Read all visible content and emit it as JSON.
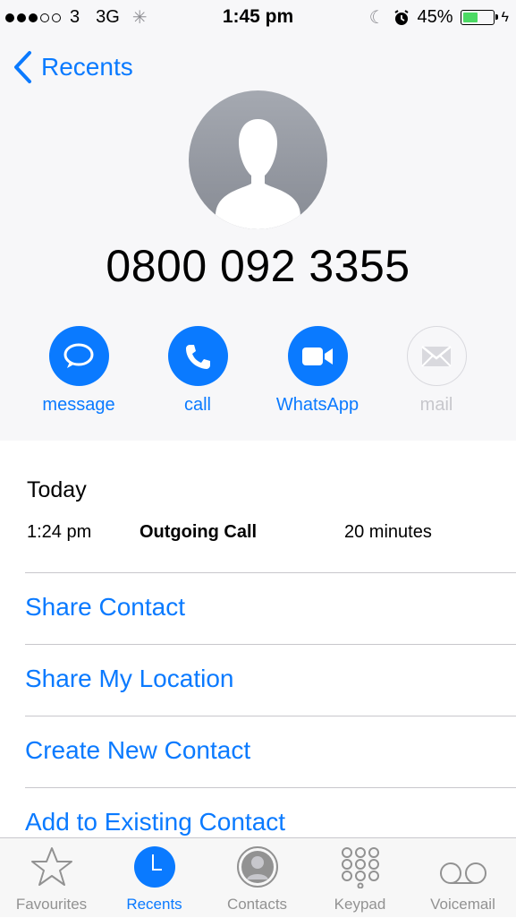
{
  "status_bar": {
    "carrier": "3",
    "network": "3G",
    "time": "1:45 pm",
    "battery": "45%",
    "battery_level": 0.45
  },
  "nav": {
    "back_label": "Recents"
  },
  "contact": {
    "phone_number": "0800 092 3355"
  },
  "actions": [
    {
      "label": "message",
      "icon": "message-icon",
      "enabled": true
    },
    {
      "label": "call",
      "icon": "phone-icon",
      "enabled": true
    },
    {
      "label": "WhatsApp",
      "icon": "video-icon",
      "enabled": true
    },
    {
      "label": "mail",
      "icon": "mail-icon",
      "enabled": false
    }
  ],
  "history": {
    "section_title": "Today",
    "entries": [
      {
        "time": "1:24 pm",
        "type": "Outgoing Call",
        "duration": "20 minutes"
      }
    ]
  },
  "options": [
    "Share Contact",
    "Share My Location",
    "Create New Contact",
    "Add to Existing Contact"
  ],
  "tab_bar": {
    "active": "Recents",
    "tabs": [
      {
        "label": "Favourites",
        "icon": "star-icon"
      },
      {
        "label": "Recents",
        "icon": "clock-icon"
      },
      {
        "label": "Contacts",
        "icon": "contacts-icon"
      },
      {
        "label": "Keypad",
        "icon": "keypad-icon"
      },
      {
        "label": "Voicemail",
        "icon": "voicemail-icon"
      }
    ]
  },
  "colors": {
    "accent": "#0a7aff",
    "battery": "#4cd964",
    "disabled": "#c7c7cc"
  }
}
